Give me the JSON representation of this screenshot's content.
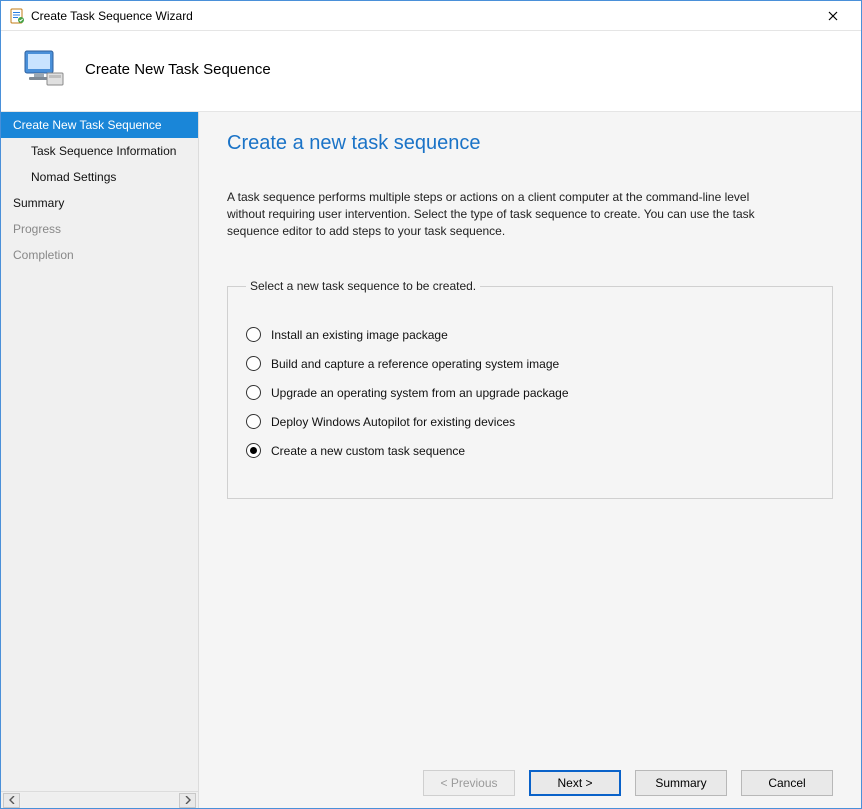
{
  "window": {
    "title": "Create Task Sequence Wizard"
  },
  "header": {
    "subtitle": "Create New Task Sequence"
  },
  "sidebar": {
    "items": [
      {
        "label": "Create New Task Sequence",
        "level": 1,
        "selected": true,
        "disabled": false
      },
      {
        "label": "Task Sequence Information",
        "level": 2,
        "selected": false,
        "disabled": false
      },
      {
        "label": "Nomad Settings",
        "level": 2,
        "selected": false,
        "disabled": false
      },
      {
        "label": "Summary",
        "level": 1,
        "selected": false,
        "disabled": false
      },
      {
        "label": "Progress",
        "level": 1,
        "selected": false,
        "disabled": true
      },
      {
        "label": "Completion",
        "level": 1,
        "selected": false,
        "disabled": true
      }
    ]
  },
  "page": {
    "title": "Create a new task sequence",
    "description": "A task sequence performs multiple steps or actions on a client computer at the command-line level without requiring user intervention. Select the type of task sequence to create. You can use the task sequence editor to add steps to your task sequence.",
    "group_legend": "Select a new task sequence to be created.",
    "options": [
      {
        "label": "Install an existing image package",
        "checked": false
      },
      {
        "label": "Build and capture a reference operating system image",
        "checked": false
      },
      {
        "label": "Upgrade an operating system from an upgrade package",
        "checked": false
      },
      {
        "label": "Deploy Windows Autopilot for existing devices",
        "checked": false
      },
      {
        "label": "Create a new custom task sequence",
        "checked": true
      }
    ]
  },
  "buttons": {
    "previous": "< Previous",
    "next": "Next >",
    "summary": "Summary",
    "cancel": "Cancel"
  }
}
